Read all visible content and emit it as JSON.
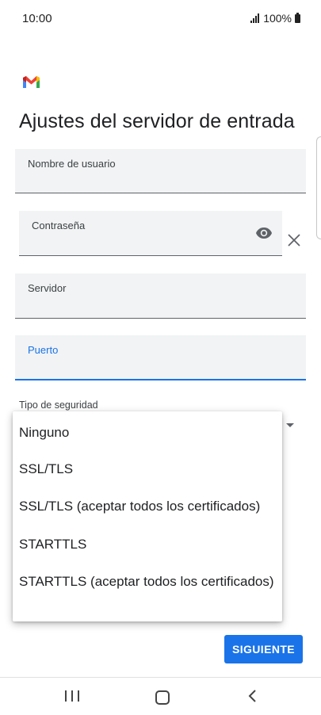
{
  "status_bar": {
    "time": "10:00",
    "battery": "100%"
  },
  "app": {
    "logo_icon": "gmail-logo-icon"
  },
  "page": {
    "title": "Ajustes del servidor de entrada"
  },
  "fields": {
    "username": {
      "label": "Nombre de usuario",
      "value": ""
    },
    "password": {
      "label": "Contraseña",
      "value": ""
    },
    "server": {
      "label": "Servidor",
      "value": ""
    },
    "port": {
      "label": "Puerto",
      "value": ""
    }
  },
  "security": {
    "label": "Tipo de seguridad",
    "options": [
      "Ninguno",
      "SSL/TLS",
      "SSL/TLS (aceptar todos los certificados)",
      "STARTTLS",
      "STARTTLS (aceptar todos los certificados)"
    ]
  },
  "actions": {
    "next_label": "SIGUIENTE"
  },
  "colors": {
    "accent": "#1a73e8",
    "field_background": "#f1f3f4",
    "text": "#202124"
  },
  "icons": [
    "signal-icon",
    "battery-icon",
    "gmail-logo-icon",
    "eye-icon",
    "clear-icon",
    "dropdown-arrow-icon",
    "nav-recents-icon",
    "nav-home-icon",
    "nav-back-icon"
  ]
}
